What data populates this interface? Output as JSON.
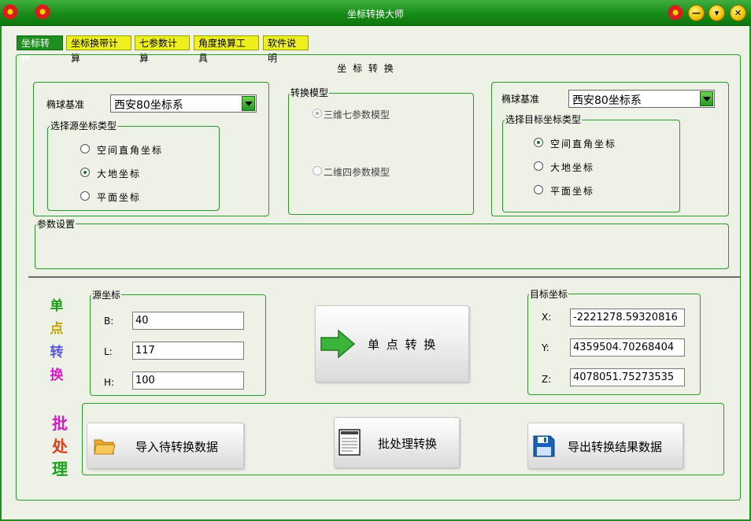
{
  "window": {
    "title": "坐标转换大师"
  },
  "titlebar_buttons": {
    "minimize": "—",
    "dropdown": "▾",
    "close": "✕"
  },
  "tabs": [
    "坐标转换",
    "坐标换带计算",
    "七参数计算",
    "角度换算工具",
    "软件说明"
  ],
  "section_title": "坐 标 转 换",
  "source_panel": {
    "ellipsoid_label": "椭球基准",
    "ellipsoid_value": "西安80坐标系",
    "type_legend": "选择源坐标类型",
    "options": [
      "空间直角坐标",
      "大地坐标",
      "平面坐标"
    ],
    "selected": "大地坐标"
  },
  "model_panel": {
    "legend": "转换模型",
    "options": [
      "三维七参数模型",
      "二维四参数模型"
    ],
    "selected": "三维七参数模型"
  },
  "target_panel": {
    "ellipsoid_label": "椭球基准",
    "ellipsoid_value": "西安80坐标系",
    "type_legend": "选择目标坐标类型",
    "options": [
      "空间直角坐标",
      "大地坐标",
      "平面坐标"
    ],
    "selected": "空间直角坐标"
  },
  "params": {
    "legend": "参数设置"
  },
  "single_point": {
    "side_label": [
      "单",
      "点",
      "转",
      "换"
    ],
    "source": {
      "legend": "源坐标",
      "labels": [
        "B:",
        "L:",
        "H:"
      ],
      "values": [
        "40",
        "117",
        "100"
      ]
    },
    "button_label": "单 点 转 换",
    "target": {
      "legend": "目标坐标",
      "labels": [
        "X:",
        "Y:",
        "Z:"
      ],
      "values": [
        "-2221278.59320816",
        "4359504.70268404",
        "4078051.75273535"
      ]
    }
  },
  "batch": {
    "side_label": [
      "批",
      "处",
      "理"
    ],
    "import_label": "导入待转换数据",
    "process_label": "批处理转换",
    "export_label": "导出转换结果数据"
  },
  "colors": {
    "accent": "#1e8f1e",
    "tab_inactive": "#eef01c",
    "arrow": "#3ab43a"
  }
}
